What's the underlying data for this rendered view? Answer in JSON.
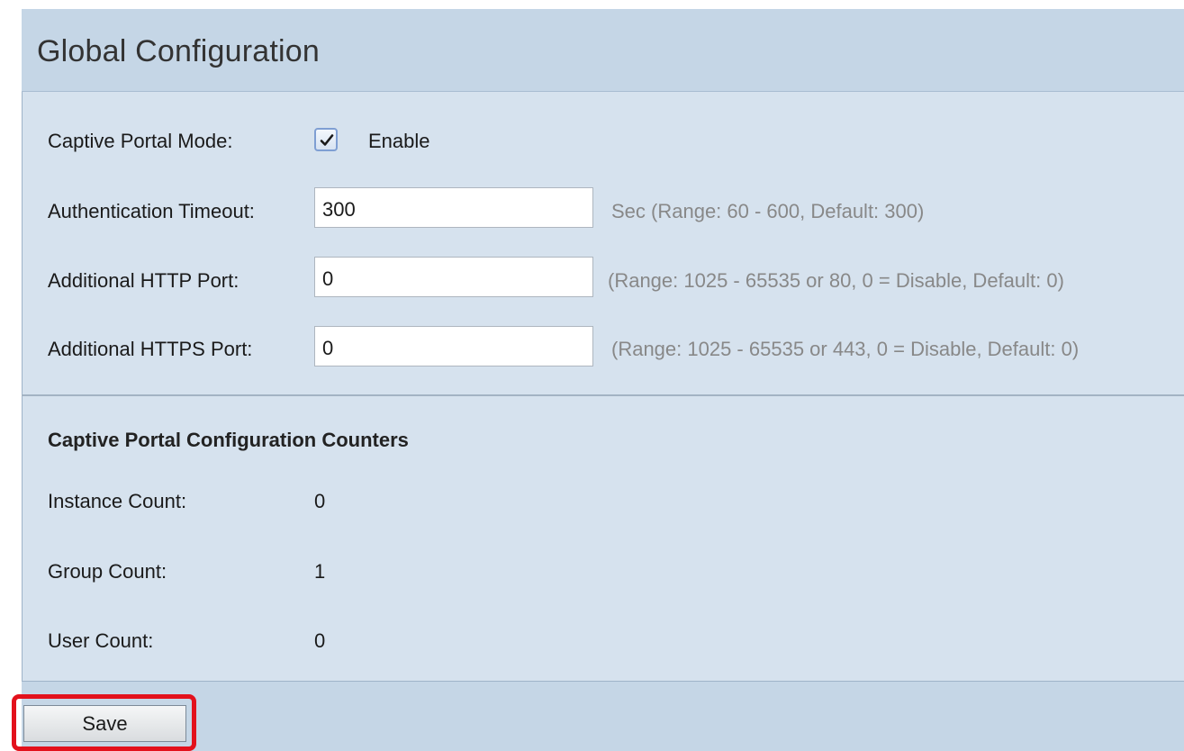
{
  "page": {
    "title": "Global Configuration"
  },
  "form": {
    "captive_portal_mode": {
      "label": "Captive Portal Mode:",
      "checked": true,
      "option_label": "Enable"
    },
    "auth_timeout": {
      "label": "Authentication Timeout:",
      "value": "300",
      "hint": "Sec (Range: 60 - 600, Default: 300)"
    },
    "http_port": {
      "label": "Additional HTTP Port:",
      "value": "0",
      "hint": "(Range: 1025 - 65535 or 80, 0 = Disable, Default: 0)"
    },
    "https_port": {
      "label": "Additional HTTPS Port:",
      "value": "0",
      "hint": "(Range: 1025 - 65535 or 443, 0 = Disable, Default: 0)"
    }
  },
  "counters": {
    "title": "Captive Portal Configuration Counters",
    "instance": {
      "label": "Instance Count:",
      "value": "0"
    },
    "group": {
      "label": "Group Count:",
      "value": "1"
    },
    "user": {
      "label": "User Count:",
      "value": "0"
    }
  },
  "actions": {
    "save_label": "Save"
  },
  "colors": {
    "title_bar": "#c5d6e6",
    "panel": "#d6e2ee",
    "hint_text": "#888888",
    "highlight": "#e3111c"
  },
  "icons": {
    "checkbox": "checkmark-icon"
  }
}
